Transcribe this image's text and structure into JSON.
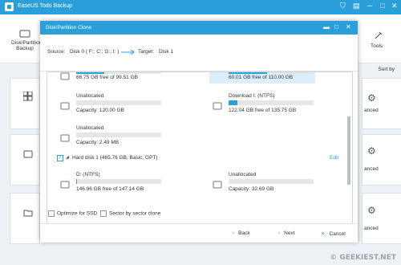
{
  "app": {
    "title": "EaseUS Todo Backup",
    "toolbar_left": "Disk/Partition\nBackup",
    "toolbar_right": "Tools",
    "sort_label": "Sort by",
    "card_right_labels": [
      "anced",
      "anced",
      "anced"
    ]
  },
  "dialog": {
    "title": "Disk/Partition Clone",
    "source_label": "Source:",
    "source_value": "Disk 0 ( F:; C:; G:; I: )",
    "target_label": "Target:",
    "target_value": "Disk 1",
    "partitions": [
      {
        "name": "",
        "info": "66.75 GB free of 99.51 GB",
        "fill": 0.33
      },
      {
        "name": "",
        "info": "60.01 GB free of 110.00 GB",
        "fill": 0.45
      },
      {
        "name": "Unallocated",
        "info": "Capacity: 120.00 GB",
        "fill": 0
      },
      {
        "name": "Download I: (NTFS)",
        "info": "122.04 GB free of 135.75 GB",
        "fill": 0.1
      },
      {
        "name": "Unallocated",
        "info": "Capacity: 2.49 MB",
        "fill": 0
      }
    ],
    "disk_header": "Hard disk 1 (465.76 GB, Basic, GPT)",
    "edit_label": "Edit",
    "disk1_partitions": [
      {
        "name": "D: (NTFS)",
        "info": "146.96 GB free of 147.14 GB",
        "fill": 0.01
      },
      {
        "name": "Unallocated",
        "info": "Capacity: 32.69 GB",
        "fill": 0
      }
    ],
    "optimize_ssd": "Optimize for SSD",
    "sector_clone": "Sector by sector clone",
    "back_label": "Back",
    "next_label": "Next",
    "cancel_label": "Cancel"
  },
  "watermark": "© GEEKIEST.NET",
  "colors": {
    "accent": "#2b9fd9"
  }
}
